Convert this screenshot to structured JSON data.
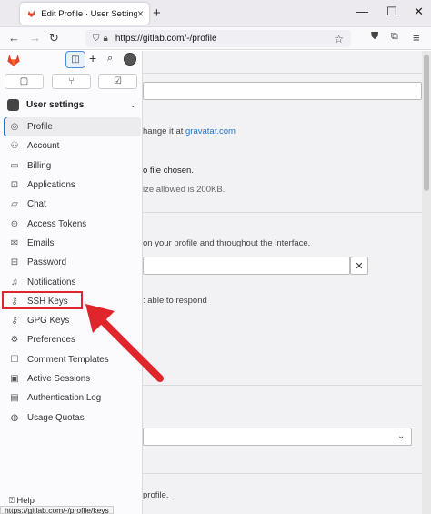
{
  "browser": {
    "tab_title": "Edit Profile · User Settings · GitL",
    "url": "https://gitlab.com/-/profile",
    "status_url": "https://gitlab.com/-/profile/keys"
  },
  "sidebar": {
    "group_title": "User settings",
    "items": [
      {
        "label": "Profile",
        "icon": "profile-icon"
      },
      {
        "label": "Account",
        "icon": "account-icon"
      },
      {
        "label": "Billing",
        "icon": "billing-icon"
      },
      {
        "label": "Applications",
        "icon": "applications-icon"
      },
      {
        "label": "Chat",
        "icon": "chat-icon"
      },
      {
        "label": "Access Tokens",
        "icon": "token-icon"
      },
      {
        "label": "Emails",
        "icon": "email-icon"
      },
      {
        "label": "Password",
        "icon": "password-icon"
      },
      {
        "label": "Notifications",
        "icon": "bell-icon"
      },
      {
        "label": "SSH Keys",
        "icon": "key-icon"
      },
      {
        "label": "GPG Keys",
        "icon": "key-icon"
      },
      {
        "label": "Preferences",
        "icon": "preferences-icon"
      },
      {
        "label": "Comment Templates",
        "icon": "comment-icon"
      },
      {
        "label": "Active Sessions",
        "icon": "session-icon"
      },
      {
        "label": "Authentication Log",
        "icon": "log-icon"
      },
      {
        "label": "Usage Quotas",
        "icon": "quota-icon"
      }
    ],
    "help_label": "Help"
  },
  "page": {
    "gravatar_prefix": "hange it at",
    "gravatar_link": "gravatar.com",
    "no_file": "o file chosen.",
    "size_note": "ize allowed is 200KB.",
    "status_note": "on your profile and throughout the interface.",
    "busy_note": ": able to respond",
    "bottom_note": "profile."
  },
  "colors": {
    "accent": "#1f75cb",
    "annotation_red": "#e0262d",
    "gitlab_orange": "#e24329"
  }
}
